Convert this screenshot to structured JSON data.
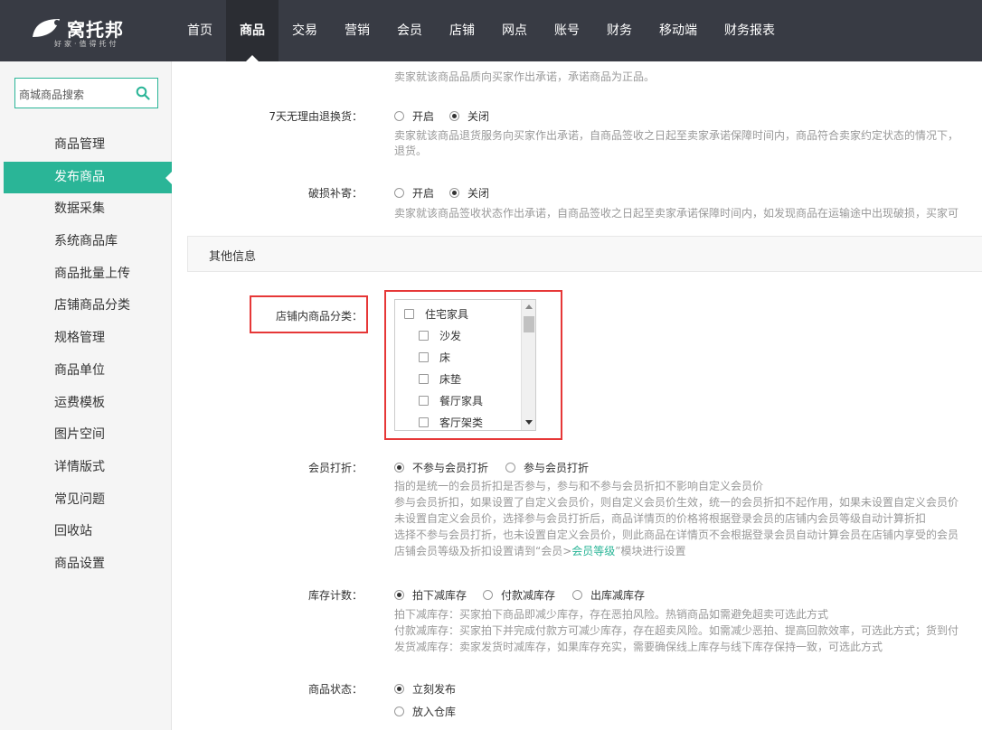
{
  "header": {
    "logo_title": "窝托邦",
    "logo_sub": "好家·值得托付",
    "nav": [
      "首页",
      "商品",
      "交易",
      "营销",
      "会员",
      "店铺",
      "网点",
      "账号",
      "财务",
      "移动端",
      "财务报表"
    ],
    "nav_active": "商品"
  },
  "sidebar": {
    "search_placeholder": "商城商品搜索",
    "items": [
      "商品管理",
      "发布商品",
      "数据采集",
      "系统商品库",
      "商品批量上传",
      "店铺商品分类",
      "规格管理",
      "商品单位",
      "运费模板",
      "图片空间",
      "详情版式",
      "常见问题",
      "回收站",
      "商品设置"
    ],
    "active": "发布商品"
  },
  "form": {
    "top_help": "卖家就该商品品质向买家作出承诺，承诺商品为正品。",
    "return7": {
      "label": "7天无理由退换货：",
      "options": [
        "开启",
        "关闭"
      ],
      "selected": "关闭",
      "help_lines": [
        "卖家就该商品退货服务向买家作出承诺，自商品签收之日起至卖家承诺保障时间内，商品符合卖家约定状态的情况下，",
        "退货。"
      ]
    },
    "damage": {
      "label": "破损补寄：",
      "options": [
        "开启",
        "关闭"
      ],
      "selected": "关闭",
      "help": "卖家就该商品签收状态作出承诺，自商品签收之日起至卖家承诺保障时间内，如发现商品在运输途中出现破损，买家可"
    },
    "section_title": "其他信息",
    "store_category": {
      "label": "店铺内商品分类：",
      "items": [
        {
          "name": "住宅家具",
          "level": 0
        },
        {
          "name": "沙发",
          "level": 1
        },
        {
          "name": "床",
          "level": 1
        },
        {
          "name": "床垫",
          "level": 1
        },
        {
          "name": "餐厅家具",
          "level": 1
        },
        {
          "name": "客厅架类",
          "level": 1
        }
      ]
    },
    "member_discount": {
      "label": "会员打折：",
      "options": [
        "不参与会员打折",
        "参与会员打折"
      ],
      "selected": "不参与会员打折",
      "help_lines": [
        "指的是统一的会员折扣是否参与，参与和不参与会员折扣不影响自定义会员价",
        "参与会员折扣，如果设置了自定义会员价，则自定义会员价生效，统一的会员折扣不起作用，如果未设置自定义会员价",
        "未设置自定义会员价，选择参与会员打折后，商品详情页的价格将根据登录会员的店铺内会员等级自动计算折扣",
        "选择不参与会员打折，也未设置自定义会员价，则此商品在详情页不会根据登录会员自动计算会员在店铺内享受的会员"
      ],
      "help_last_prefix": "店铺会员等级及折扣设置请到“会员>",
      "help_last_link": "会员等级",
      "help_last_suffix": "”模块进行设置"
    },
    "stock": {
      "label": "库存计数：",
      "options": [
        "拍下减库存",
        "付款减库存",
        "出库减库存"
      ],
      "selected": "拍下减库存",
      "help_lines": [
        "拍下减库存：买家拍下商品即减少库存，存在恶拍风险。热销商品如需避免超卖可选此方式",
        "付款减库存：买家拍下并完成付款方可减少库存，存在超卖风险。如需减少恶拍、提高回款效率，可选此方式；货到付",
        "发货减库存：卖家发货时减库存，如果库存充实，需要确保线上库存与线下库存保持一致，可选此方式"
      ]
    },
    "status": {
      "label": "商品状态：",
      "options": [
        "立刻发布",
        "放入仓库"
      ],
      "selected": "立刻发布"
    }
  },
  "colors": {
    "accent": "#2ab597",
    "header_bg": "#383b44",
    "highlight_box": "#e63737"
  }
}
